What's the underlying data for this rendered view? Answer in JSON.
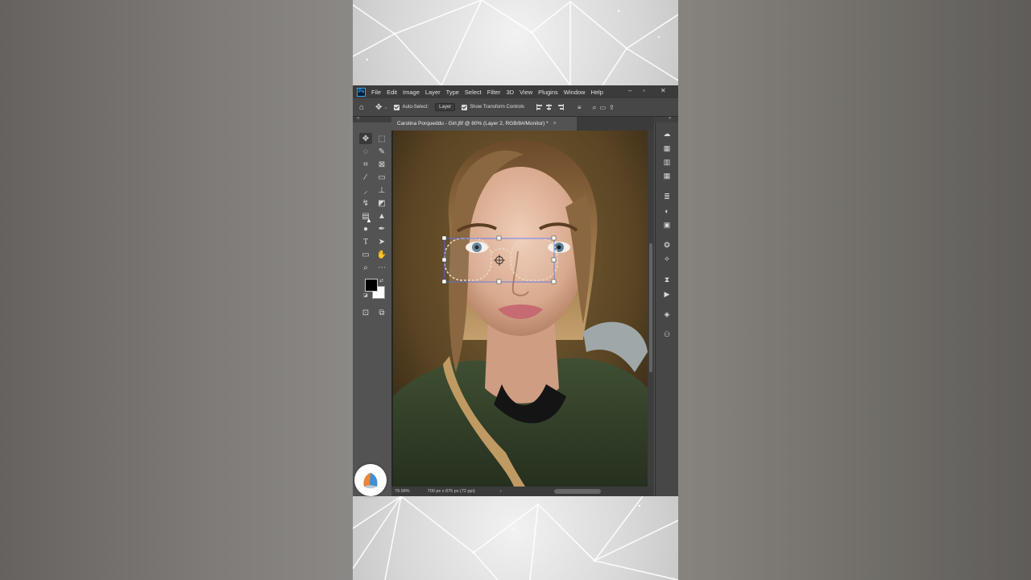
{
  "menu": {
    "app_badge": "Ps",
    "items": [
      "File",
      "Edit",
      "Image",
      "Layer",
      "Type",
      "Select",
      "Filter",
      "3D",
      "View",
      "Plugins",
      "Window",
      "Help"
    ],
    "window_controls": [
      "–",
      "▫",
      "✕"
    ]
  },
  "options_bar": {
    "auto_select_label": "Auto-Select:",
    "auto_select_checked": true,
    "target_select": "Layer",
    "show_transform_label": "Show Transform Controls",
    "show_transform_checked": true
  },
  "document": {
    "tab_title": "Carolina Porqueddu - Girl.jfif @ 80% (Layer 2, RGB/8#/Monitor) *",
    "close_glyph": "×"
  },
  "status": {
    "zoom": "79.98%",
    "doc_info": "700 px x 875 px (72 ppi)",
    "arrow": "›"
  },
  "tools": [
    "move-tool",
    "artboard-tool",
    "lasso-tool",
    "quick-select-tool",
    "crop-tool",
    "frame-tool",
    "eyedropper-tool",
    "ruler-tool",
    "brush-tool",
    "stamp-tool",
    "history-brush-tool",
    "eraser-tool",
    "gradient-tool",
    "triangle-tool",
    "dodge-tool",
    "pen-tool",
    "type-tool",
    "path-select-tool",
    "rectangle-tool",
    "hand-tool",
    "zoom-tool",
    "more-tools"
  ],
  "colors": {
    "foreground": "#000000",
    "background": "#ffffff",
    "accent": "#31a8ff"
  }
}
